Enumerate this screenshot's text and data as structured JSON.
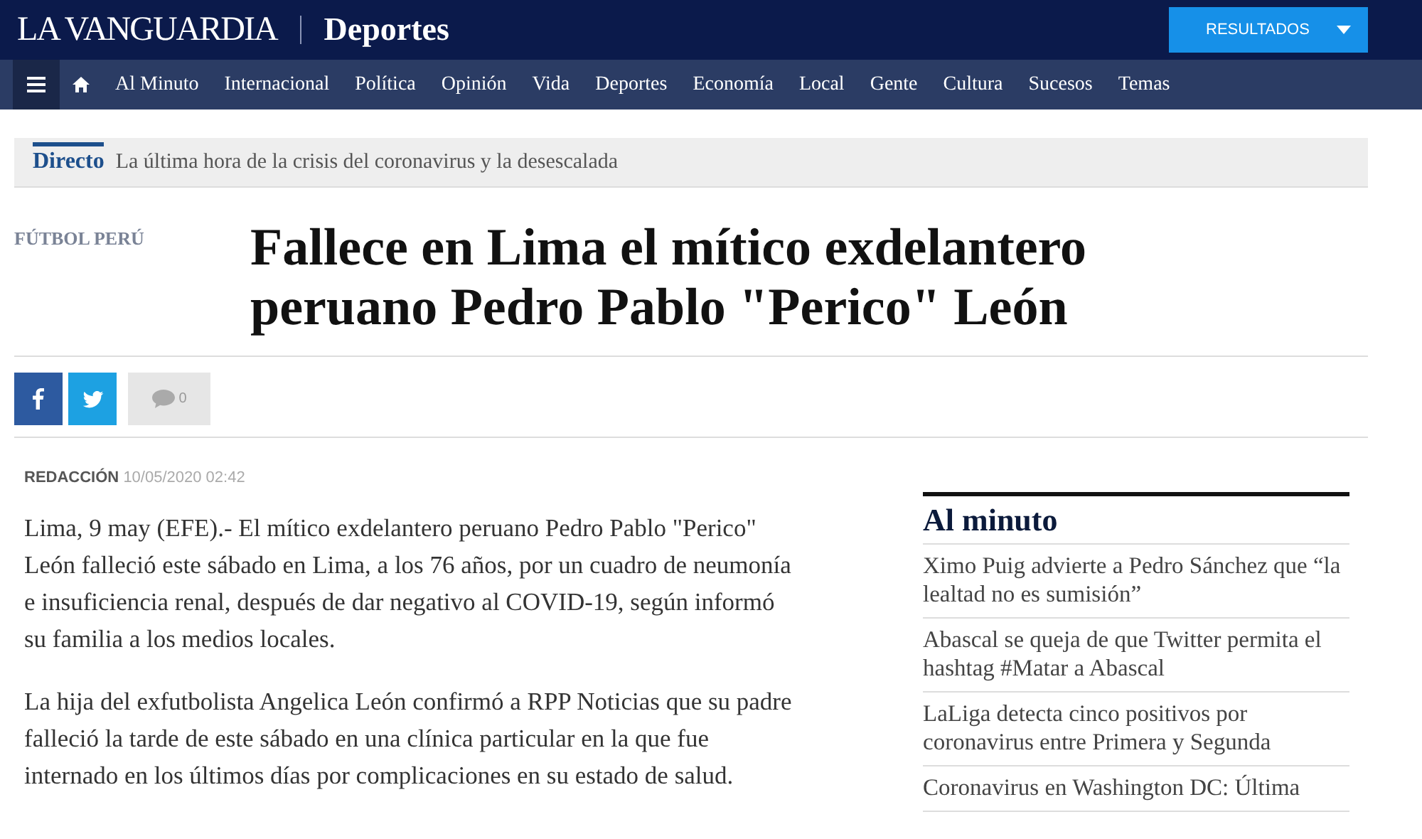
{
  "header": {
    "logo": "LA VANGUARDIA",
    "section": "Deportes",
    "results_button": "RESULTADOS"
  },
  "nav": {
    "items": [
      "Al Minuto",
      "Internacional",
      "Política",
      "Opinión",
      "Vida",
      "Deportes",
      "Economía",
      "Local",
      "Gente",
      "Cultura",
      "Sucesos",
      "Temas"
    ]
  },
  "live_bar": {
    "label": "Directo",
    "text": "La última hora de la crisis del coronavirus y la desescalada"
  },
  "article": {
    "category": "FÚTBOL PERÚ",
    "title": "Fallece en Lima el mítico exdelantero peruano Pedro Pablo \"Perico\" León",
    "comment_count": "0",
    "author": "REDACCIÓN",
    "date": "10/05/2020 02:42",
    "paragraphs": [
      "Lima, 9 may (EFE).- El mítico exdelantero peruano Pedro Pablo \"Perico\" León falleció este sábado en Lima, a los 76 años, por un cuadro de neumonía e insuficiencia renal, después de dar negativo al COVID-19, según informó su familia a los medios locales.",
      "La hija del exfutbolista Angelica León confirmó a RPP Noticias que su padre falleció la tarde de este sábado en una clínica particular en la que fue internado en los últimos días por complicaciones en su estado de salud."
    ]
  },
  "sidebar": {
    "title": "Al minuto",
    "items": [
      "Ximo Puig advierte a Pedro Sánchez que “la lealtad no es sumisión”",
      "Abascal se queja de que Twitter permita el hashtag #Matar a Abascal",
      "LaLiga detecta cinco positivos por coronavirus entre Primera y Segunda",
      "Coronavirus en Washington DC: Última"
    ]
  }
}
